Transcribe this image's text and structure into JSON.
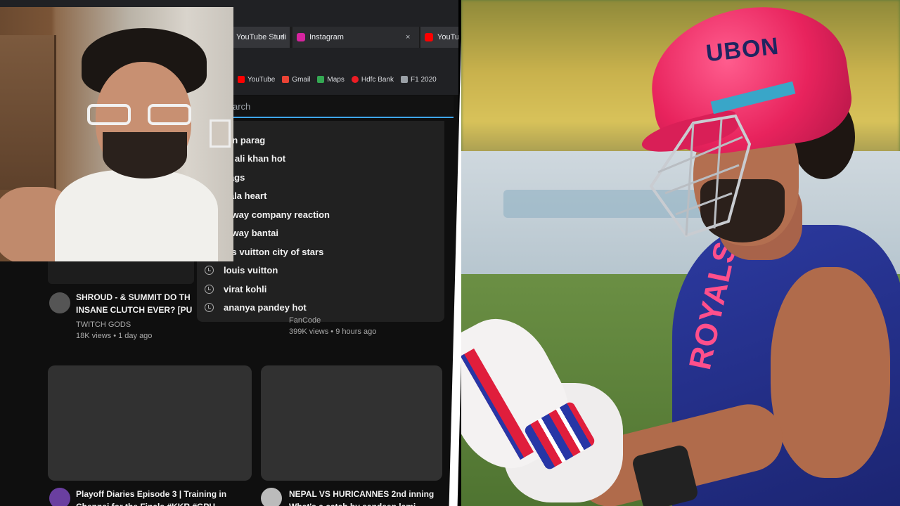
{
  "browser": {
    "tabs": [
      {
        "label": "YouTube Studi",
        "close": "×",
        "favicon_color": "#cc0000"
      },
      {
        "label": "Instagram",
        "close": "×",
        "favicon_color": "#d6249f"
      },
      {
        "label": "YouTu",
        "favicon_color": "#ff0000"
      }
    ],
    "bookmarks": [
      {
        "label": "YouTube",
        "icon": "youtube-icon",
        "color": "#ff0000"
      },
      {
        "label": "Gmail",
        "icon": "gmail-icon",
        "color": "#ea4335"
      },
      {
        "label": "Maps",
        "icon": "maps-icon",
        "color": "#34a853"
      },
      {
        "label": "Hdfc Bank",
        "icon": "hdfc-icon",
        "color": "#ed1c24"
      },
      {
        "label": "F1 2020",
        "icon": "f1-icon",
        "color": "#9aa0a6"
      }
    ]
  },
  "search": {
    "placeholder": "arch",
    "suggestions": [
      {
        "text": "ran parag",
        "history": false
      },
      {
        "text": "ra ali khan hot",
        "history": false
      },
      {
        "text": "nags",
        "history": false
      },
      {
        "text": "pala heart",
        "history": false
      },
      {
        "text": "niway company reaction",
        "history": false
      },
      {
        "text": "niway bantai",
        "history": false
      },
      {
        "text": "uis vuitton city of stars",
        "history": false
      },
      {
        "text": "louis vuitton",
        "history": true
      },
      {
        "text": "virat kohli",
        "history": true
      },
      {
        "text": "ananya pandey hot",
        "history": true
      }
    ]
  },
  "feed": {
    "videos": [
      {
        "title_1": "SHROUD - & SUMMIT DO TH",
        "title_2": "INSANE CLUTCH EVER? [PU",
        "channel": "TWITCH GODS",
        "stats": "18K views • 1 day ago"
      },
      {
        "channel": "FanCode",
        "stats": "399K views • 9 hours ago"
      },
      {
        "title_1": "Playoff Diaries Episode 3 | Training in",
        "title_2": "Chennai for the Finals #KKR #GPU"
      },
      {
        "title_1": "NEPAL VS HURICANNES 2nd inning",
        "title_2": "What's a catch by sandeep lami"
      }
    ]
  },
  "photo": {
    "helmet_logo": "UBON",
    "jersey_text": "ROYALS"
  },
  "colors": {
    "yt_bg": "#0f0f0f",
    "search_accent": "#3ea6ff",
    "helmet": "#e8235d",
    "jersey": "#2c3aa0"
  }
}
